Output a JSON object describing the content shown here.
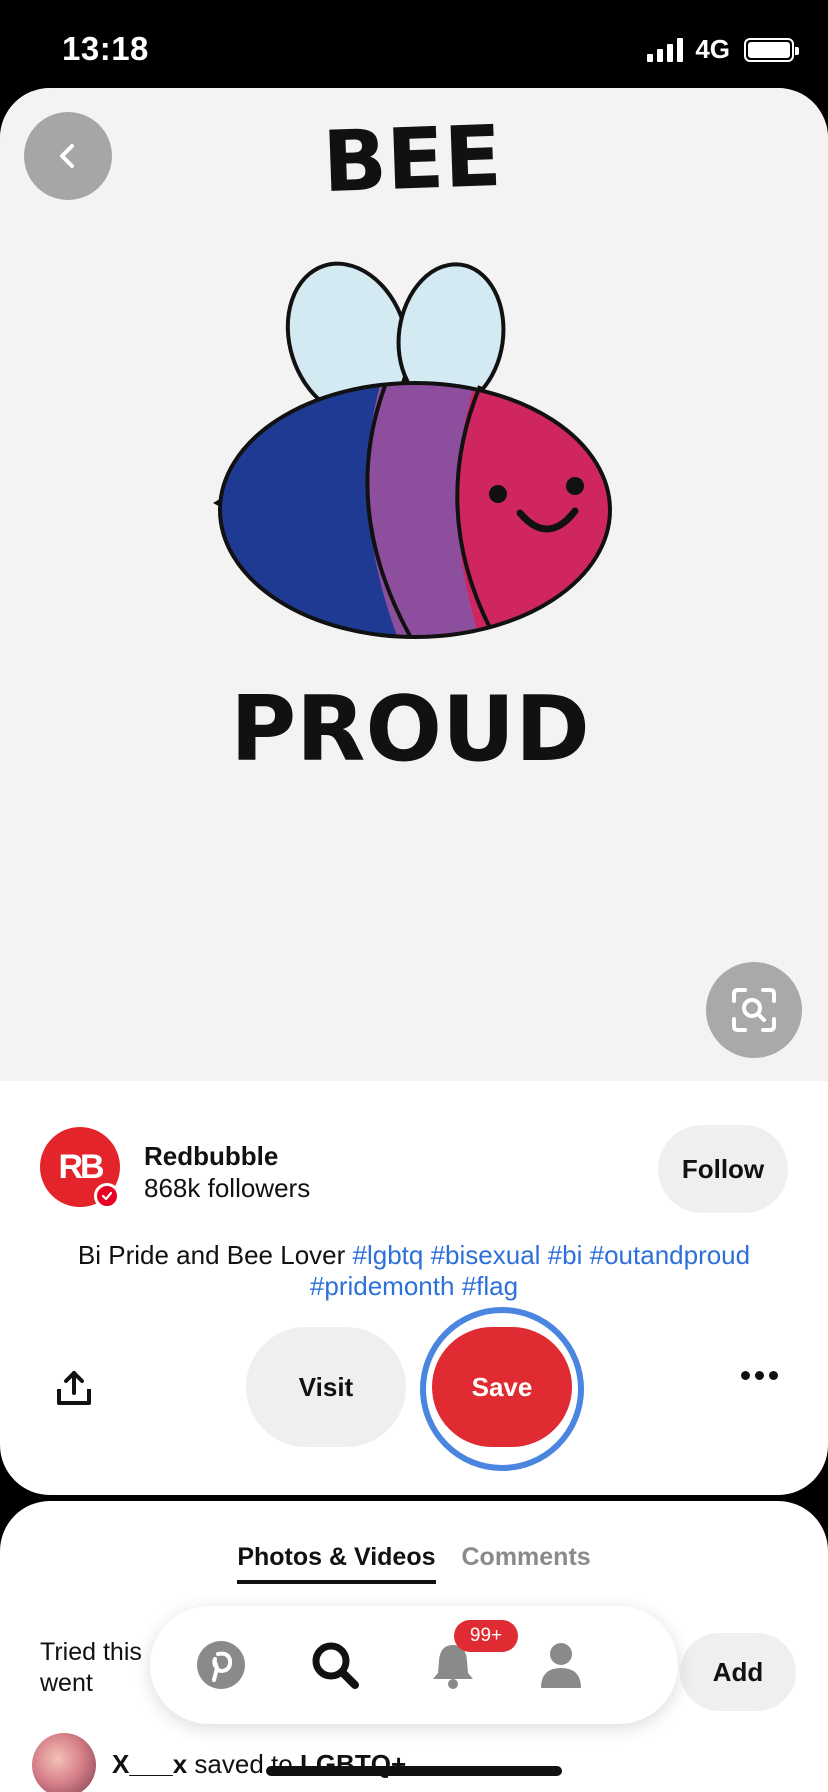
{
  "status_bar": {
    "time": "13:18",
    "network": "4G"
  },
  "pin": {
    "image_text_top": "BEE",
    "image_text_bottom": "PROUD",
    "colors": {
      "blue": "#1f3a93",
      "purple": "#8e4e9e",
      "magenta": "#cf2661",
      "wing": "#d4eaf2"
    }
  },
  "creator": {
    "avatar_text": "RB",
    "name": "Redbubble",
    "followers": "868k followers",
    "follow_label": "Follow"
  },
  "description": {
    "text": "Bi Pride and Bee Lover ",
    "hashtags": [
      "#lgbtq",
      "#bisexual",
      "#bi",
      "#outandproud",
      "#pridemonth",
      "#flag"
    ]
  },
  "actions": {
    "visit_label": "Visit",
    "save_label": "Save"
  },
  "comments": {
    "tabs": [
      {
        "label": "Photos & Videos",
        "active": true
      },
      {
        "label": "Comments",
        "active": false
      }
    ],
    "tried_line1": "Tried this",
    "tried_line2": "went",
    "add_label": "Add",
    "saved_user": "X___x",
    "saved_action": "saved to",
    "saved_board": "LGBTQ+"
  },
  "bottom_nav": {
    "items": [
      "home-icon",
      "search-icon",
      "notifications-icon",
      "profile-icon"
    ],
    "notif_count": "99+"
  },
  "theme": {
    "accent": "#e02b33",
    "link": "#2d6fdb",
    "focus_ring": "#4a85e0"
  }
}
